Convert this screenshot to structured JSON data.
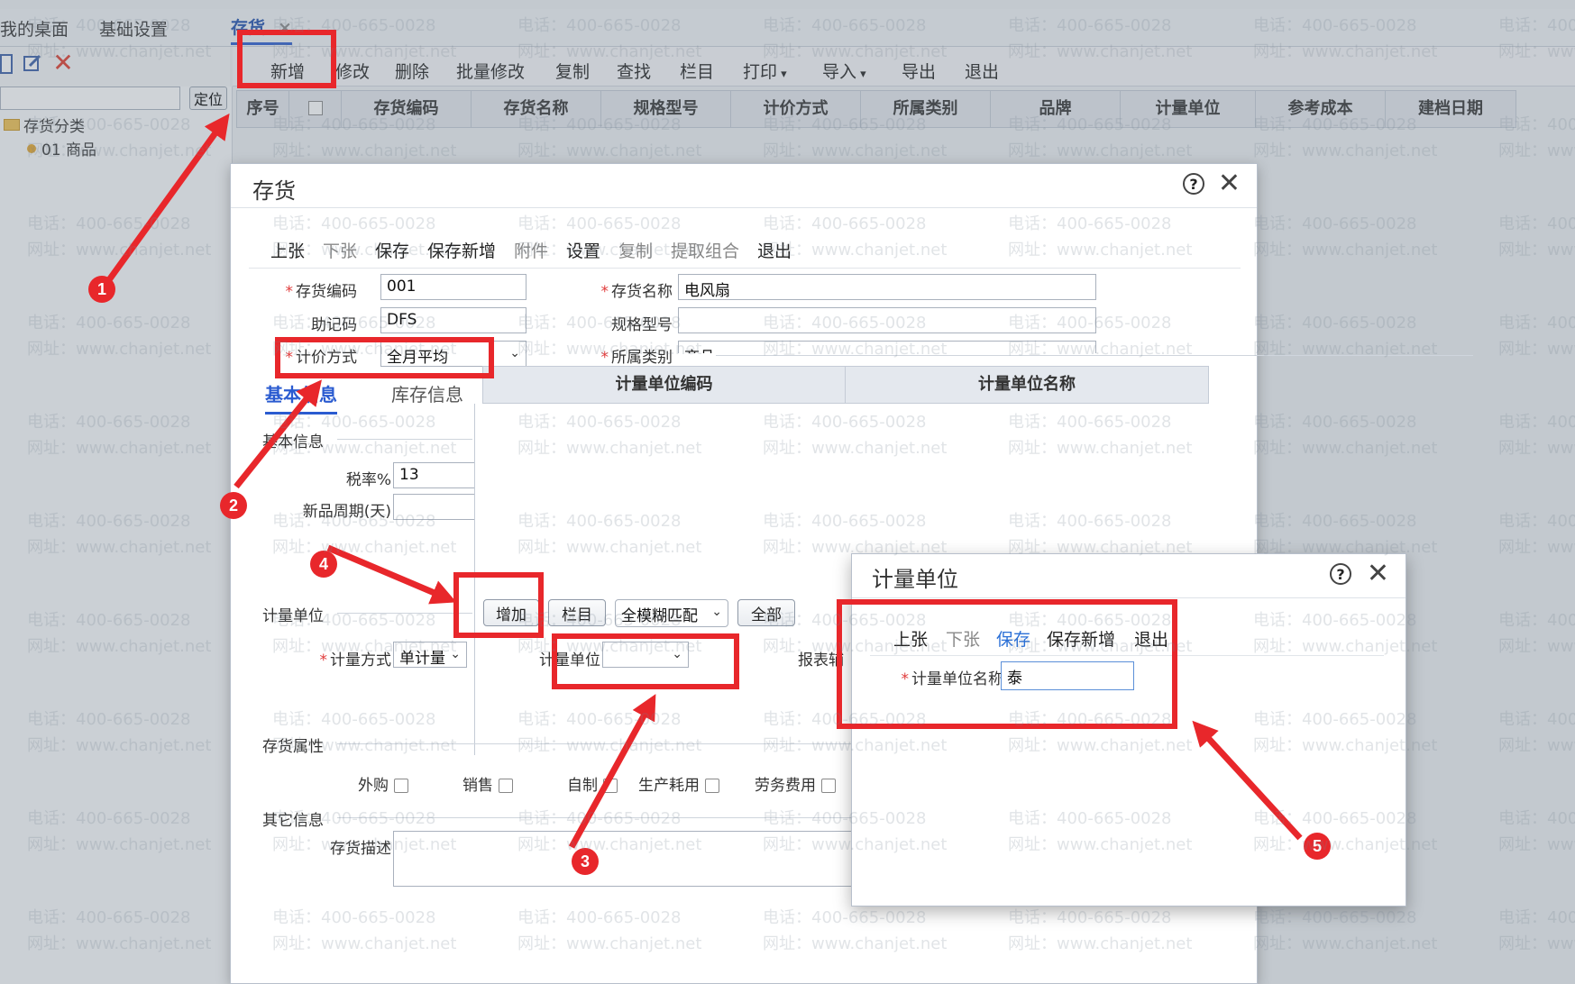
{
  "app_tabs": [
    {
      "label": "我的桌面"
    },
    {
      "label": "基础设置"
    },
    {
      "label": "存货"
    }
  ],
  "tab_close_glyph": "×",
  "left_panel": {
    "locate_button": "定位",
    "tree_root": "存货分类",
    "tree_child": "01 商品"
  },
  "main_toolbar": [
    "新增",
    "修改",
    "删除",
    "批量修改",
    "复制",
    "查找",
    "栏目",
    "打印",
    "导入",
    "导出",
    "退出"
  ],
  "grid_columns": [
    "序号",
    "存货编码",
    "存货名称",
    "规格型号",
    "计价方式",
    "所属类别",
    "品牌",
    "计量单位",
    "参考成本",
    "建档日期"
  ],
  "watermark": {
    "phone": "电话：400-665-0028",
    "site": "网址：www.chanjet.net"
  },
  "dialog": {
    "title": "存货",
    "toolbar": [
      {
        "label": "上张",
        "state": "normal"
      },
      {
        "label": "下张",
        "state": "disabled"
      },
      {
        "label": "保存",
        "state": "normal"
      },
      {
        "label": "保存新增",
        "state": "normal"
      },
      {
        "label": "附件",
        "state": "disabled"
      },
      {
        "label": "设置",
        "state": "normal"
      },
      {
        "label": "复制",
        "state": "disabled"
      },
      {
        "label": "提取组合",
        "state": "disabled"
      },
      {
        "label": "退出",
        "state": "normal"
      }
    ],
    "fields": {
      "code_label": "存货编码",
      "code_value": "001",
      "name_label": "存货名称",
      "name_value": "电风扇",
      "mnemonic_label": "助记码",
      "mnemonic_value": "DFS",
      "spec_label": "规格型号",
      "spec_value": "",
      "pricing_label": "计价方式",
      "pricing_value": "全月平均",
      "category_label": "所属类别",
      "category_value": "商品"
    },
    "subtabs": [
      "基本信息",
      "库存信息"
    ],
    "basic_section": "基本信息",
    "tax_label": "税率%",
    "tax_value": "13",
    "period_label": "新品周期(天)",
    "period_value": "",
    "unit_grid_columns": [
      "计量单位编码",
      "计量单位名称"
    ],
    "unit_section": "计量单位",
    "btn_add": "增加",
    "btn_columns": "栏目",
    "match_select": "全模糊匹配",
    "btn_all": "全部",
    "measure_method_label": "计量方式",
    "measure_method_value": "单计量",
    "measure_unit_label": "计量单位",
    "measure_unit_value": "",
    "report_aux_label": "报表辅",
    "attr_section": "存货属性",
    "attrs": [
      "外购",
      "销售",
      "自制",
      "生产耗用",
      "劳务费用"
    ],
    "other_section": "其它信息",
    "desc_label": "存货描述"
  },
  "dialog2": {
    "title": "计量单位",
    "toolbar": [
      {
        "label": "上张",
        "state": "normal"
      },
      {
        "label": "下张",
        "state": "disabled"
      },
      {
        "label": "保存",
        "state": "active"
      },
      {
        "label": "保存新增",
        "state": "normal"
      },
      {
        "label": "退出",
        "state": "normal"
      }
    ],
    "name_label": "计量单位名称",
    "name_value": "泰"
  },
  "annotations": [
    "1",
    "2",
    "3",
    "4",
    "5"
  ],
  "colors": {
    "annotation": "#e8272b",
    "active_blue": "#2a5bd0",
    "required": "#e03a3a"
  }
}
